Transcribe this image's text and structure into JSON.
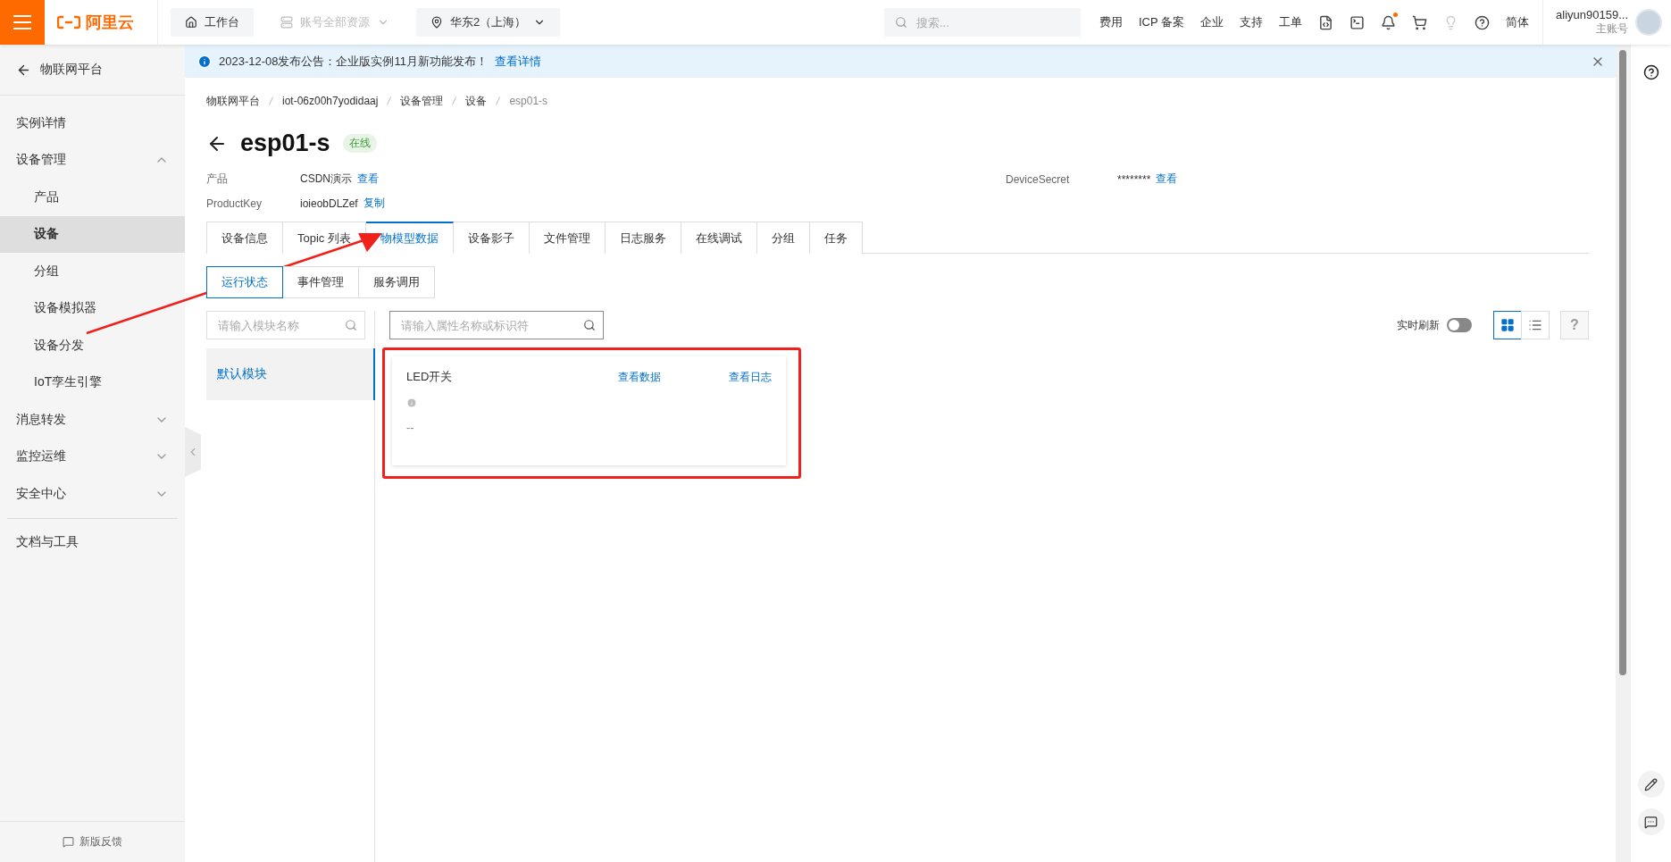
{
  "topbar": {
    "brand": "阿里云",
    "workbench": "工作台",
    "account": {
      "label": "账号全部资源",
      "disabled": true
    },
    "region": "华东2（上海）",
    "search": {
      "placeholder": "搜索..."
    },
    "links": [
      "费用",
      "ICP 备案",
      "企业",
      "支持",
      "工单"
    ],
    "language": "简体",
    "user": {
      "name": "aliyun90159...",
      "role": "主账号"
    }
  },
  "sidebar": {
    "back": "物联网平台",
    "items": [
      {
        "kind": "item",
        "label": "实例详情"
      },
      {
        "kind": "group",
        "label": "设备管理",
        "expanded": true,
        "children": [
          {
            "label": "产品",
            "selected": false
          },
          {
            "label": "设备",
            "selected": true
          },
          {
            "label": "分组",
            "selected": false
          },
          {
            "label": "设备模拟器",
            "selected": false
          },
          {
            "label": "设备分发",
            "selected": false
          },
          {
            "label": "IoT孪生引擎",
            "selected": false
          }
        ]
      },
      {
        "kind": "group",
        "label": "消息转发",
        "expanded": false
      },
      {
        "kind": "group",
        "label": "监控运维",
        "expanded": false
      },
      {
        "kind": "group",
        "label": "安全中心",
        "expanded": false
      },
      {
        "kind": "divider"
      },
      {
        "kind": "item",
        "label": "文档与工具"
      }
    ],
    "feedback": "新版反馈"
  },
  "notice": {
    "text": "2023-12-08发布公告：企业版实例11月新功能发布！",
    "link": "查看详情"
  },
  "breadcrumb": [
    "物联网平台",
    "iot-06z00h7yodidaaj",
    "设备管理",
    "设备",
    "esp01-s"
  ],
  "device": {
    "name": "esp01-s",
    "status": "在线"
  },
  "info": [
    {
      "label": "产品",
      "value": "CSDN演示",
      "action": "查看"
    },
    {
      "label": "ProductKey",
      "value": "ioieobDLZef",
      "action": "复制"
    },
    {
      "label": "DeviceSecret",
      "value": "********",
      "action": "查看"
    }
  ],
  "tabs": [
    {
      "label": "设备信息",
      "selected": false
    },
    {
      "label": "Topic 列表",
      "selected": false
    },
    {
      "label": "物模型数据",
      "selected": true
    },
    {
      "label": "设备影子",
      "selected": false
    },
    {
      "label": "文件管理",
      "selected": false
    },
    {
      "label": "日志服务",
      "selected": false
    },
    {
      "label": "在线调试",
      "selected": false
    },
    {
      "label": "分组",
      "selected": false
    },
    {
      "label": "任务",
      "selected": false
    }
  ],
  "subtabs": [
    {
      "label": "运行状态",
      "selected": true
    },
    {
      "label": "事件管理",
      "selected": false
    },
    {
      "label": "服务调用",
      "selected": false
    }
  ],
  "module_search": {
    "placeholder": "请输入模块名称"
  },
  "modules": [
    {
      "label": "默认模块",
      "selected": true
    }
  ],
  "property_search": {
    "placeholder": "请输入属性名称或标识符"
  },
  "realtime": {
    "label": "实时刷新",
    "on": false
  },
  "views": [
    {
      "kind": "grid",
      "selected": true
    },
    {
      "kind": "list",
      "selected": false
    }
  ],
  "help": "?",
  "cards": [
    {
      "name": "LED开关",
      "view_data": "查看数据",
      "view_log": "查看日志",
      "value": "--"
    }
  ]
}
